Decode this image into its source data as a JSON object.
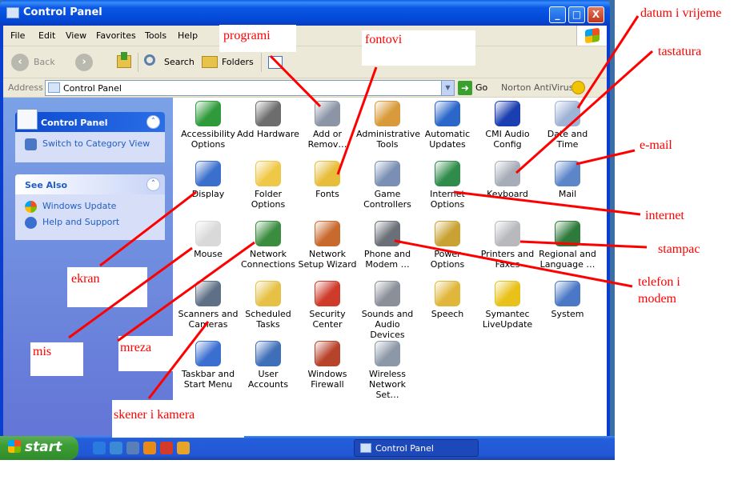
{
  "window": {
    "title": "Control Panel",
    "minimize_glyph": "_",
    "maximize_glyph": "□",
    "close_glyph": "X"
  },
  "menubar": {
    "items": [
      "File",
      "Edit",
      "View",
      "Favorites",
      "Tools",
      "Help"
    ]
  },
  "toolbar": {
    "back_label": "Back",
    "back_glyph": "‹",
    "forward_glyph": "›",
    "search_label": "Search",
    "folders_label": "Folders"
  },
  "addressbar": {
    "label": "Address",
    "value": "Control Panel",
    "go_label": "Go",
    "go_glyph": "➜",
    "drop_glyph": "▼",
    "norton_label": "Norton AntiVirus"
  },
  "sidebar": {
    "panel_title": "Control Panel",
    "switch_link": "Switch to Category View",
    "see_also_title": "See Also",
    "links": [
      "Windows Update",
      "Help and Support"
    ],
    "chevron_glyph": "˄"
  },
  "items": [
    {
      "label": "Accessibility Options",
      "icon": "accessibility-icon",
      "color": "#2e9a3a"
    },
    {
      "label": "Add Hardware",
      "icon": "add-hardware-icon",
      "color": "#6d6d6d"
    },
    {
      "label": "Add or Remov…",
      "icon": "add-remove-programs-icon",
      "color": "#8c95a6"
    },
    {
      "label": "Administrative Tools",
      "icon": "administrative-tools-icon",
      "color": "#d89a3b"
    },
    {
      "label": "Automatic Updates",
      "icon": "automatic-updates-icon",
      "color": "#2a67c9"
    },
    {
      "label": "CMI Audio Config",
      "icon": "cmi-audio-icon",
      "color": "#1b3fb0"
    },
    {
      "label": "Date and Time",
      "icon": "date-time-icon",
      "color": "#9fb3d6"
    },
    {
      "label": "Display",
      "icon": "display-icon",
      "color": "#3a6fcb"
    },
    {
      "label": "Folder Options",
      "icon": "folder-options-icon",
      "color": "#f0c848"
    },
    {
      "label": "Fonts",
      "icon": "fonts-icon",
      "color": "#e8bd3a"
    },
    {
      "label": "Game Controllers",
      "icon": "game-controllers-icon",
      "color": "#7a8fb3"
    },
    {
      "label": "Internet Options",
      "icon": "internet-options-icon",
      "color": "#2f8c4a"
    },
    {
      "label": "Keyboard",
      "icon": "keyboard-icon",
      "color": "#a7adb8"
    },
    {
      "label": "Mail",
      "icon": "mail-icon",
      "color": "#5d86c9"
    },
    {
      "label": "Mouse",
      "icon": "mouse-icon",
      "color": "#d9d9d9"
    },
    {
      "label": "Network Connections",
      "icon": "network-connections-icon",
      "color": "#3a8c3f"
    },
    {
      "label": "Network Setup Wizard",
      "icon": "network-setup-icon",
      "color": "#c8692e"
    },
    {
      "label": "Phone and Modem …",
      "icon": "phone-modem-icon",
      "color": "#6b6f78"
    },
    {
      "label": "Power Options",
      "icon": "power-options-icon",
      "color": "#c9a233"
    },
    {
      "label": "Printers and Faxes",
      "icon": "printers-faxes-icon",
      "color": "#b7b9bd"
    },
    {
      "label": "Regional and Language …",
      "icon": "regional-language-icon",
      "color": "#2d7a3a"
    },
    {
      "label": "Scanners and Cameras",
      "icon": "scanners-cameras-icon",
      "color": "#5e6f86"
    },
    {
      "label": "Scheduled Tasks",
      "icon": "scheduled-tasks-icon",
      "color": "#e6c146"
    },
    {
      "label": "Security Center",
      "icon": "security-center-icon",
      "color": "#cf3b2a"
    },
    {
      "label": "Sounds and Audio Devices",
      "icon": "sounds-audio-icon",
      "color": "#8a8f99"
    },
    {
      "label": "Speech",
      "icon": "speech-icon",
      "color": "#e0b73a"
    },
    {
      "label": "Symantec LiveUpdate",
      "icon": "symantec-liveupdate-icon",
      "color": "#e8c21a"
    },
    {
      "label": "System",
      "icon": "system-icon",
      "color": "#4a78c6"
    },
    {
      "label": "Taskbar and Start Menu",
      "icon": "taskbar-start-icon",
      "color": "#3a6fd0"
    },
    {
      "label": "User Accounts",
      "icon": "user-accounts-icon",
      "color": "#3f6fb8"
    },
    {
      "label": "Windows Firewall",
      "icon": "windows-firewall-icon",
      "color": "#b8432b"
    },
    {
      "label": "Wireless Network Set…",
      "icon": "wireless-network-icon",
      "color": "#8c98a8"
    }
  ],
  "taskbar": {
    "start_label": "start",
    "task_label": "Control Panel",
    "quicklaunch": [
      {
        "icon": "internet-explorer-icon",
        "color": "#2a7be0"
      },
      {
        "icon": "outlook-express-icon",
        "color": "#3a8ad6"
      },
      {
        "icon": "show-desktop-icon",
        "color": "#5a7fb8"
      },
      {
        "icon": "media-player-icon",
        "color": "#e88a1a"
      },
      {
        "icon": "acrobat-icon",
        "color": "#d23a2a"
      },
      {
        "icon": "clock-icon",
        "color": "#e6a42a"
      }
    ]
  },
  "annotations": [
    {
      "text": "programi"
    },
    {
      "text": "fontovi"
    },
    {
      "text": "datum i vrijeme"
    },
    {
      "text": "tastatura"
    },
    {
      "text": "e-mail"
    },
    {
      "text": "internet"
    },
    {
      "text": "stampac"
    },
    {
      "text": "telefon i"
    },
    {
      "text": "modem"
    },
    {
      "text": "ekran"
    },
    {
      "text": "mis"
    },
    {
      "text": "mreza"
    },
    {
      "text": "skener i kamera"
    }
  ],
  "colors": {
    "annotation": "#ff0000",
    "title_bar": "#0a5fe6",
    "sidebar_gradient": "#7ba2e7",
    "link": "#215dc6",
    "taskbar": "#245edb",
    "start_button": "#3c9d35"
  }
}
